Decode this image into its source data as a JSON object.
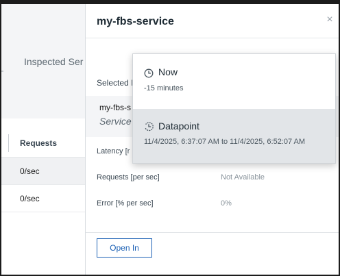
{
  "background": {
    "inspected_label": "Inspected Ser",
    "table": {
      "header": "Requests",
      "rows": [
        "0/sec",
        "0/sec"
      ]
    }
  },
  "drawer": {
    "title": "my-fbs-service",
    "close_glyph": "×",
    "selected_label": "Selected I",
    "service": {
      "name": "my-fbs-s",
      "type": "Service"
    },
    "metrics": [
      {
        "label": "Latency [r",
        "value": ""
      },
      {
        "label": "Requests [per sec]",
        "value": "Not Available"
      },
      {
        "label": "Error [% per sec]",
        "value": "0%"
      }
    ],
    "open_button": "Open In"
  },
  "time_menu": {
    "options": [
      {
        "label": "Now",
        "sublabel": "-15 minutes",
        "icon": "clock-icon",
        "highlighted": false
      },
      {
        "label": "Datapoint",
        "sublabel": "11/4/2025, 6:37:07 AM to 11/4/2025, 6:52:07 AM",
        "icon": "clock-history-icon",
        "highlighted": true
      }
    ]
  },
  "colors": {
    "accent": "#1a5fb4",
    "highlight": "#e2e5e8",
    "muted_text": "#8a949c"
  }
}
